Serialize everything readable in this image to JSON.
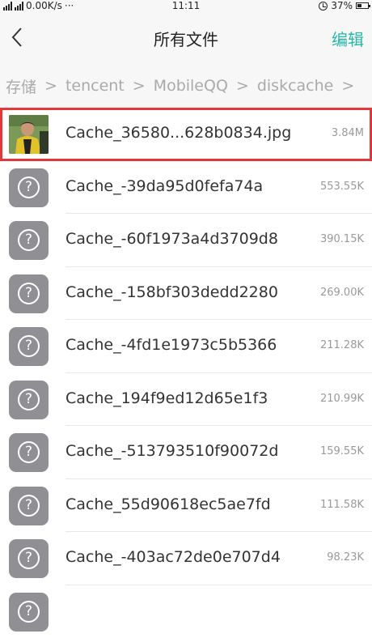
{
  "status_bar": {
    "network_speed": "0.00K/s",
    "more": "···",
    "time": "11:11",
    "battery": "37%"
  },
  "nav": {
    "title": "所有文件",
    "edit_label": "编辑"
  },
  "breadcrumb": [
    "存储",
    "tencent",
    "MobileQQ",
    "diskcache"
  ],
  "breadcrumb_separator": ">",
  "files": [
    {
      "name": "Cache_36580...628b0834.jpg",
      "size": "3.84M",
      "icon": "image-thumbnail",
      "selected": true
    },
    {
      "name": "Cache_-39da95d0fefa74a",
      "size": "553.55K",
      "icon": "unknown-file-icon"
    },
    {
      "name": "Cache_-60f1973a4d3709d8",
      "size": "390.15K",
      "icon": "unknown-file-icon"
    },
    {
      "name": "Cache_-158bf303dedd2280",
      "size": "269.00K",
      "icon": "unknown-file-icon"
    },
    {
      "name": "Cache_-4fd1e1973c5b5366",
      "size": "211.28K",
      "icon": "unknown-file-icon"
    },
    {
      "name": "Cache_194f9ed12d65e1f3",
      "size": "210.99K",
      "icon": "unknown-file-icon"
    },
    {
      "name": "Cache_-513793510f90072d",
      "size": "159.55K",
      "icon": "unknown-file-icon"
    },
    {
      "name": "Cache_55d90618ec5ae7fd",
      "size": "111.58K",
      "icon": "unknown-file-icon"
    },
    {
      "name": "Cache_-403ac72de0e707d4",
      "size": "98.23K",
      "icon": "unknown-file-icon"
    }
  ],
  "colors": {
    "accent": "#2bb5a6",
    "selection_border": "#e0393b",
    "icon_bg": "#8f8f94"
  }
}
